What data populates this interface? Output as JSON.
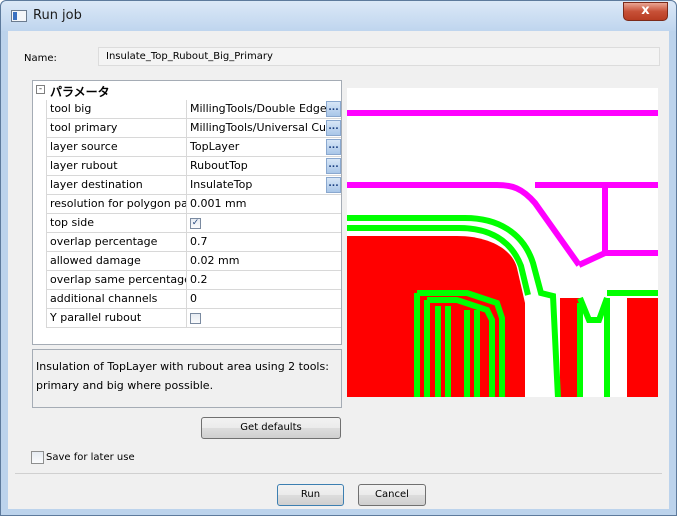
{
  "window": {
    "title": "Run job",
    "close_glyph": "x"
  },
  "name": {
    "label": "Name:",
    "value": "Insulate_Top_Rubout_Big_Primary"
  },
  "params": {
    "group_title": "パラメータ",
    "rows": [
      {
        "key": "tool big",
        "value": "MillingTools/Double Edge Tool",
        "browse": true
      },
      {
        "key": "tool primary",
        "value": "MillingTools/Universal Cutter",
        "browse": true
      },
      {
        "key": "layer source",
        "value": "TopLayer",
        "browse": true
      },
      {
        "key": "layer rubout",
        "value": "RuboutTop",
        "browse": true
      },
      {
        "key": "layer destination",
        "value": "InsulateTop",
        "browse": true
      },
      {
        "key": "resolution for polygon parts",
        "value": "0.001 mm"
      },
      {
        "key": "top side",
        "checked": true
      },
      {
        "key": "overlap percentage",
        "value": "0.7"
      },
      {
        "key": "allowed damage",
        "value": "0.02 mm"
      },
      {
        "key": "overlap same percentage",
        "value": "0.2"
      },
      {
        "key": "additional channels",
        "value": "0"
      },
      {
        "key": "Y parallel rubout",
        "checked": false
      }
    ],
    "browse_label": "..."
  },
  "description": "Insulation of TopLayer with rubout area using 2 tools: primary and big where possible.",
  "buttons": {
    "defaults": "Get defaults",
    "run": "Run",
    "cancel": "Cancel"
  },
  "save_for_later": {
    "label": "Save for later use",
    "checked": false
  },
  "preview_colors": {
    "background": "#ffffff",
    "copper": "#ff0000",
    "big_tool": "#ff00ff",
    "primary_tool": "#00ff00"
  }
}
